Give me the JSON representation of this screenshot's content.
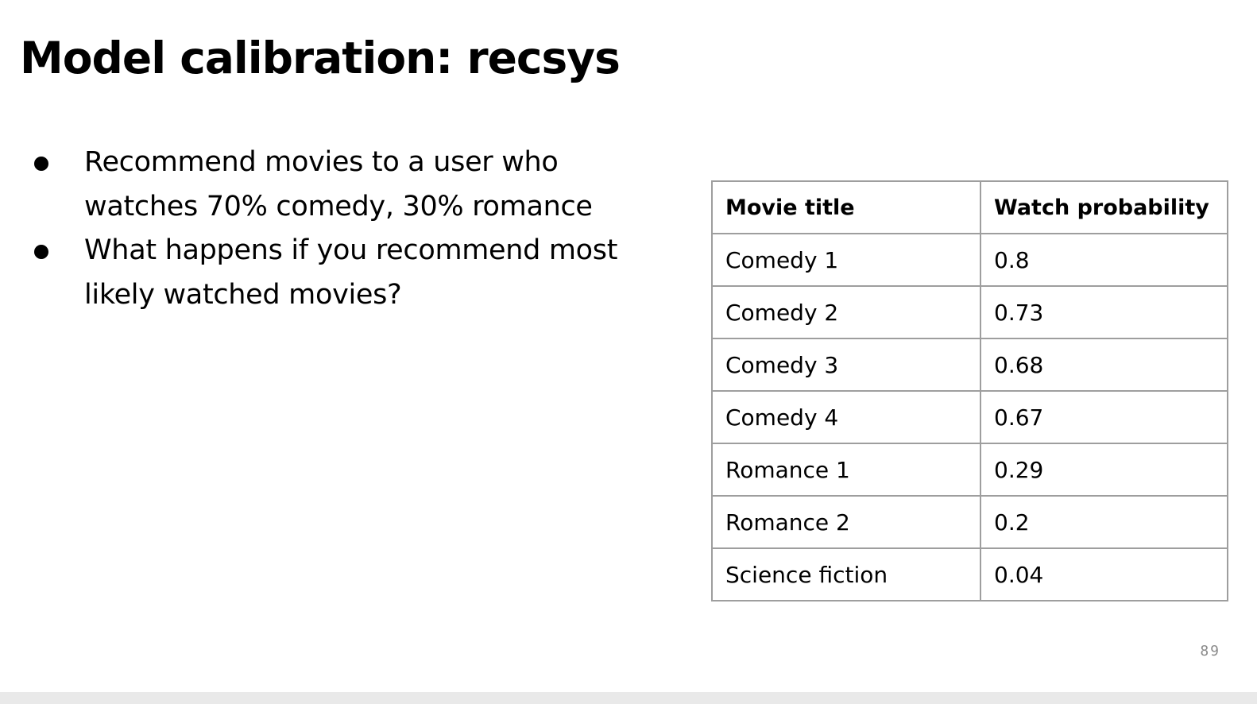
{
  "slide": {
    "title": "Model calibration: recsys",
    "bullets": [
      "Recommend movies to a user who watches 70% comedy, 30% romance",
      "What happens if you recommend most likely watched movies?"
    ],
    "page_number": "89"
  },
  "table": {
    "headers": [
      "Movie title",
      "Watch probability"
    ],
    "rows": [
      [
        "Comedy 1",
        "0.8"
      ],
      [
        "Comedy 2",
        "0.73"
      ],
      [
        "Comedy 3",
        "0.68"
      ],
      [
        "Comedy 4",
        "0.67"
      ],
      [
        "Romance 1",
        "0.29"
      ],
      [
        "Romance 2",
        "0.2"
      ],
      [
        "Science fiction",
        "0.04"
      ]
    ]
  }
}
